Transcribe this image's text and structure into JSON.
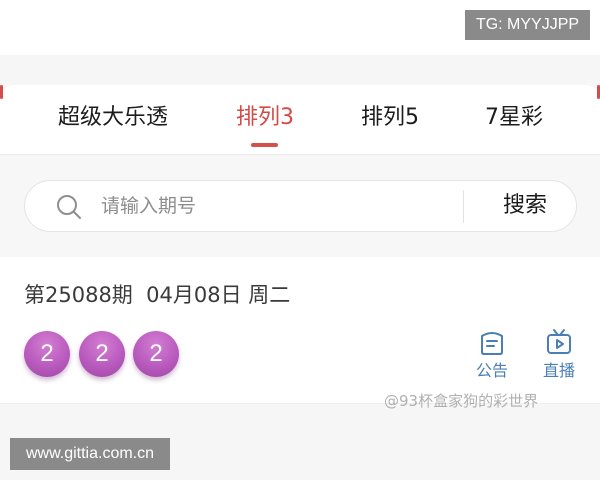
{
  "watermarks": {
    "telegram": "TG: MYYJJPP",
    "website": "www.gittia.com.cn",
    "weibo": "@93杯盒家狗的彩世界"
  },
  "tabs": [
    {
      "label": "超级大乐透",
      "active": false
    },
    {
      "label": "排列3",
      "active": true
    },
    {
      "label": "排列5",
      "active": false
    },
    {
      "label": "7星彩",
      "active": false
    }
  ],
  "search": {
    "placeholder": "请输入期号",
    "value": "",
    "button_label": "搜索",
    "icon": "search-icon"
  },
  "result": {
    "draw_info": "第25088期  04月08日 周二",
    "balls": [
      "2",
      "2",
      "2"
    ],
    "actions": [
      {
        "label": "公告",
        "icon": "announcement-icon"
      },
      {
        "label": "直播",
        "icon": "live-tv-icon"
      }
    ]
  },
  "colors": {
    "accent": "#d24b46",
    "ball": "#b95bbe",
    "action": "#4a7fb5"
  }
}
